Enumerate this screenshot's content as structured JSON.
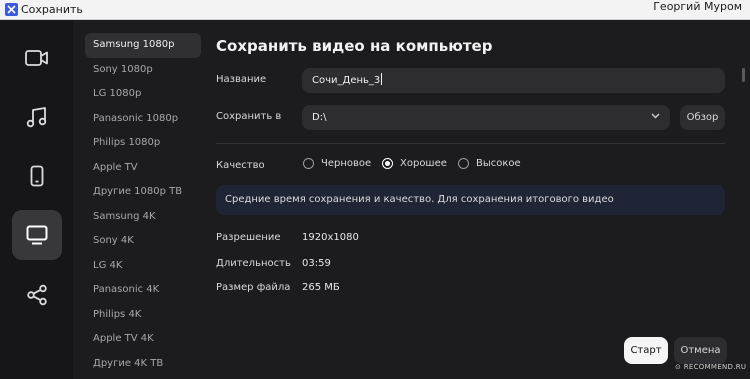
{
  "window": {
    "title": "Сохранить",
    "user": "Георгий Муром"
  },
  "rail": {
    "icons": [
      "video-icon",
      "music-icon",
      "phone-icon",
      "monitor-icon",
      "share-icon"
    ],
    "active": "monitor-icon"
  },
  "presets": {
    "items": [
      "Samsung 1080p",
      "Sony 1080p",
      "LG 1080p",
      "Panasonic 1080p",
      "Philips 1080p",
      "Apple TV",
      "Другие 1080p ТВ",
      "Samsung 4K",
      "Sony 4K",
      "LG 4K",
      "Panasonic 4K",
      "Philips 4K",
      "Apple TV 4K",
      "Другие 4K ТВ"
    ],
    "selected": "Samsung 1080p"
  },
  "main": {
    "heading": "Сохранить видео на компьютер",
    "name_label": "Название",
    "name_value": "Сочи_День_3",
    "save_to_label": "Сохранить в",
    "save_to_value": "D:\\",
    "browse_label": "Обзор",
    "quality_label": "Качество",
    "quality_options": [
      "Черновое",
      "Хорошее",
      "Высокое"
    ],
    "quality_selected": "Хорошее",
    "info_text": "Средние время сохранения и качество. Для сохранения итогового видео",
    "resolution_label": "Разрешение",
    "resolution_value": "1920x1080",
    "duration_label": "Длительность",
    "duration_value": "03:59",
    "filesize_label": "Размер файла",
    "filesize_value": "265 МБ",
    "start_label": "Старт",
    "cancel_label": "Отмена"
  },
  "watermark": "⊙ RECOMMEND.RU",
  "colors": {
    "background": "#1c1c1e",
    "rail": "#161618",
    "active": "#38383c",
    "info_bg": "#202535",
    "title_icon": "#3a5bd9"
  }
}
